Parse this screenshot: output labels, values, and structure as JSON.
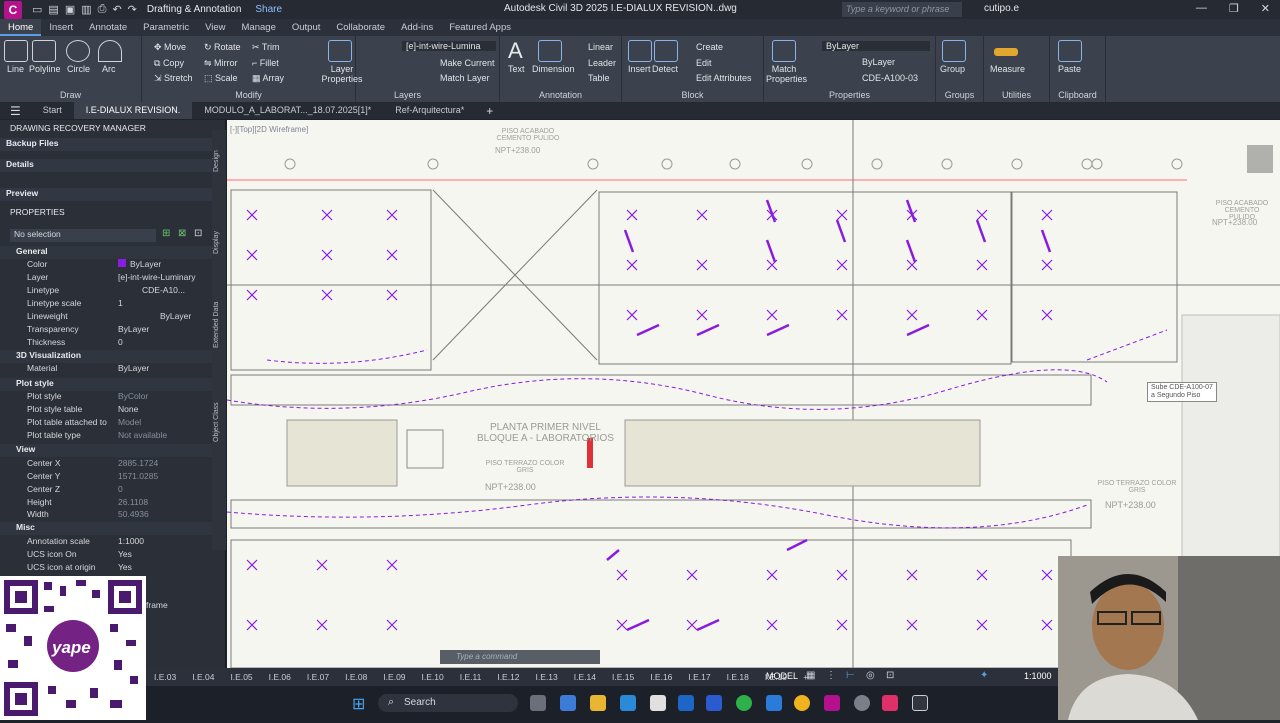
{
  "app": {
    "logo_letter": "C",
    "workspace": "Drafting & Annotation",
    "share": "Share",
    "title": "Autodesk Civil 3D 2025   I.E-DIALUX REVISION..dwg",
    "search_placeholder": "Type a keyword or phrase",
    "user": "cutipo.e"
  },
  "ribbon_tabs": [
    "Home",
    "Insert",
    "Annotate",
    "Parametric",
    "View",
    "Manage",
    "Output",
    "Collaborate",
    "Add-ins",
    "Featured Apps"
  ],
  "ribbon": {
    "draw": {
      "label": "Draw",
      "line": "Line",
      "polyline": "Polyline",
      "circle": "Circle",
      "arc": "Arc"
    },
    "modify": {
      "label": "Modify",
      "move": "Move",
      "rotate": "Rotate",
      "trim": "Trim",
      "copy": "Copy",
      "mirror": "Mirror",
      "fillet": "Fillet",
      "stretch": "Stretch",
      "scale": "Scale",
      "array": "Array"
    },
    "layers": {
      "label": "Layers",
      "properties": "Layer Properties",
      "current_layer": "[e]-int-wire-Lumina",
      "make_current": "Make Current",
      "match_layer": "Match Layer"
    },
    "annotation": {
      "label": "Annotation",
      "text": "Text",
      "dimension": "Dimension",
      "linear": "Linear",
      "leader": "Leader",
      "table": "Table"
    },
    "block": {
      "label": "Block",
      "insert": "Insert",
      "detect": "Detect",
      "create": "Create",
      "edit": "Edit",
      "edit_attributes": "Edit Attributes"
    },
    "properties": {
      "label": "Properties",
      "match": "Match Properties",
      "color": "ByLayer",
      "lineweight": "ByLayer",
      "linetype": "CDE-A100-03"
    },
    "groups": {
      "label": "Groups",
      "group": "Group"
    },
    "utilities": {
      "label": "Utilities",
      "measure": "Measure"
    },
    "clipboard": {
      "label": "Clipboard",
      "paste": "Paste"
    }
  },
  "doc_tabs": [
    "Start",
    "I.E-DIALUX REVISION.",
    "MODULO_A_LABORAT..._18.07.2025[1]*",
    "Ref-Arquitectura*"
  ],
  "left_panel": {
    "recovery_title": "DRAWING RECOVERY MANAGER",
    "backup_files": "Backup Files",
    "details": "Details",
    "preview": "Preview",
    "properties_title": "PROPERTIES",
    "selection": "No selection",
    "general": "General",
    "color_key": "Color",
    "color_val": "ByLayer",
    "layer_key": "Layer",
    "layer_val": "[e]-int-wire-Luminary",
    "linetype_key": "Linetype",
    "linetype_val": "CDE-A10...",
    "ltscale_key": "Linetype scale",
    "ltscale_val": "1",
    "lineweight_key": "Lineweight",
    "lineweight_val": "ByLayer",
    "transparency_key": "Transparency",
    "transparency_val": "ByLayer",
    "thickness_key": "Thickness",
    "thickness_val": "0",
    "viz": "3D Visualization",
    "material_key": "Material",
    "material_val": "ByLayer",
    "plot": "Plot style",
    "plotstyle_key": "Plot style",
    "plotstyle_val": "ByColor",
    "plottable_key": "Plot style table",
    "plottable_val": "None",
    "plotattached_key": "Plot table attached to",
    "plotattached_val": "Model",
    "plottype_key": "Plot table type",
    "plottype_val": "Not available",
    "view": "View",
    "cx_key": "Center X",
    "cx_val": "2885.1724",
    "cy_key": "Center Y",
    "cy_val": "1571.0285",
    "cz_key": "Center Z",
    "cz_val": "0",
    "height_key": "Height",
    "height_val": "26.1108",
    "width_key": "Width",
    "width_val": "50.4936",
    "misc": "Misc",
    "annoscale_key": "Annotation scale",
    "annoscale_val": "1:1000",
    "ucson_key": "UCS icon On",
    "ucson_val": "Yes",
    "ucsorigin_key": "UCS icon at origin",
    "ucsorigin_val": "Yes",
    "frame_text": "frame",
    "vtabs": [
      "Design",
      "Display",
      "Extended Data",
      "Object Class"
    ]
  },
  "drawing": {
    "viewport_label": "[-][Top][2D Wireframe]",
    "title_line1": "PLANTA PRIMER NIVEL",
    "title_line2": "BLOQUE A - LABORATORIOS",
    "npt_left": "NPT+238.00",
    "npt_right": "NPT+238.00",
    "terrazo_left": "PISO TERRAZO COLOR GRIS",
    "terrazo_right": "PISO TERRAZO COLOR GRIS",
    "note": "Sube CDE-A100-07 a Segundo Piso",
    "cementado_top": "PISO ACABADO CEMENTO PULIDO",
    "npt_top": "NPT+238.00",
    "cementado_right": "PISO ACABADO CEMENTO PULIDO",
    "npt_top_right": "NPT+238.00"
  },
  "command_placeholder": "Type a command",
  "status": {
    "layouts": [
      "I.E.03",
      "I.E.04",
      "I.E.05",
      "I.E.06",
      "I.E.07",
      "I.E.08",
      "I.E.09",
      "I.E.10",
      "I.E.11",
      "I.E.12",
      "I.E.13",
      "I.E.14",
      "I.E.15",
      "I.E.16",
      "I.E.17",
      "I.E.18",
      "I.E.19"
    ],
    "model": "MODEL",
    "scale": "1:1000"
  },
  "taskbar": {
    "search": "Search"
  },
  "qr": {
    "brand": "yape"
  },
  "colors": {
    "accent": "#5a9fe6",
    "wire": "#8a1be0",
    "app": "#b3128c"
  }
}
